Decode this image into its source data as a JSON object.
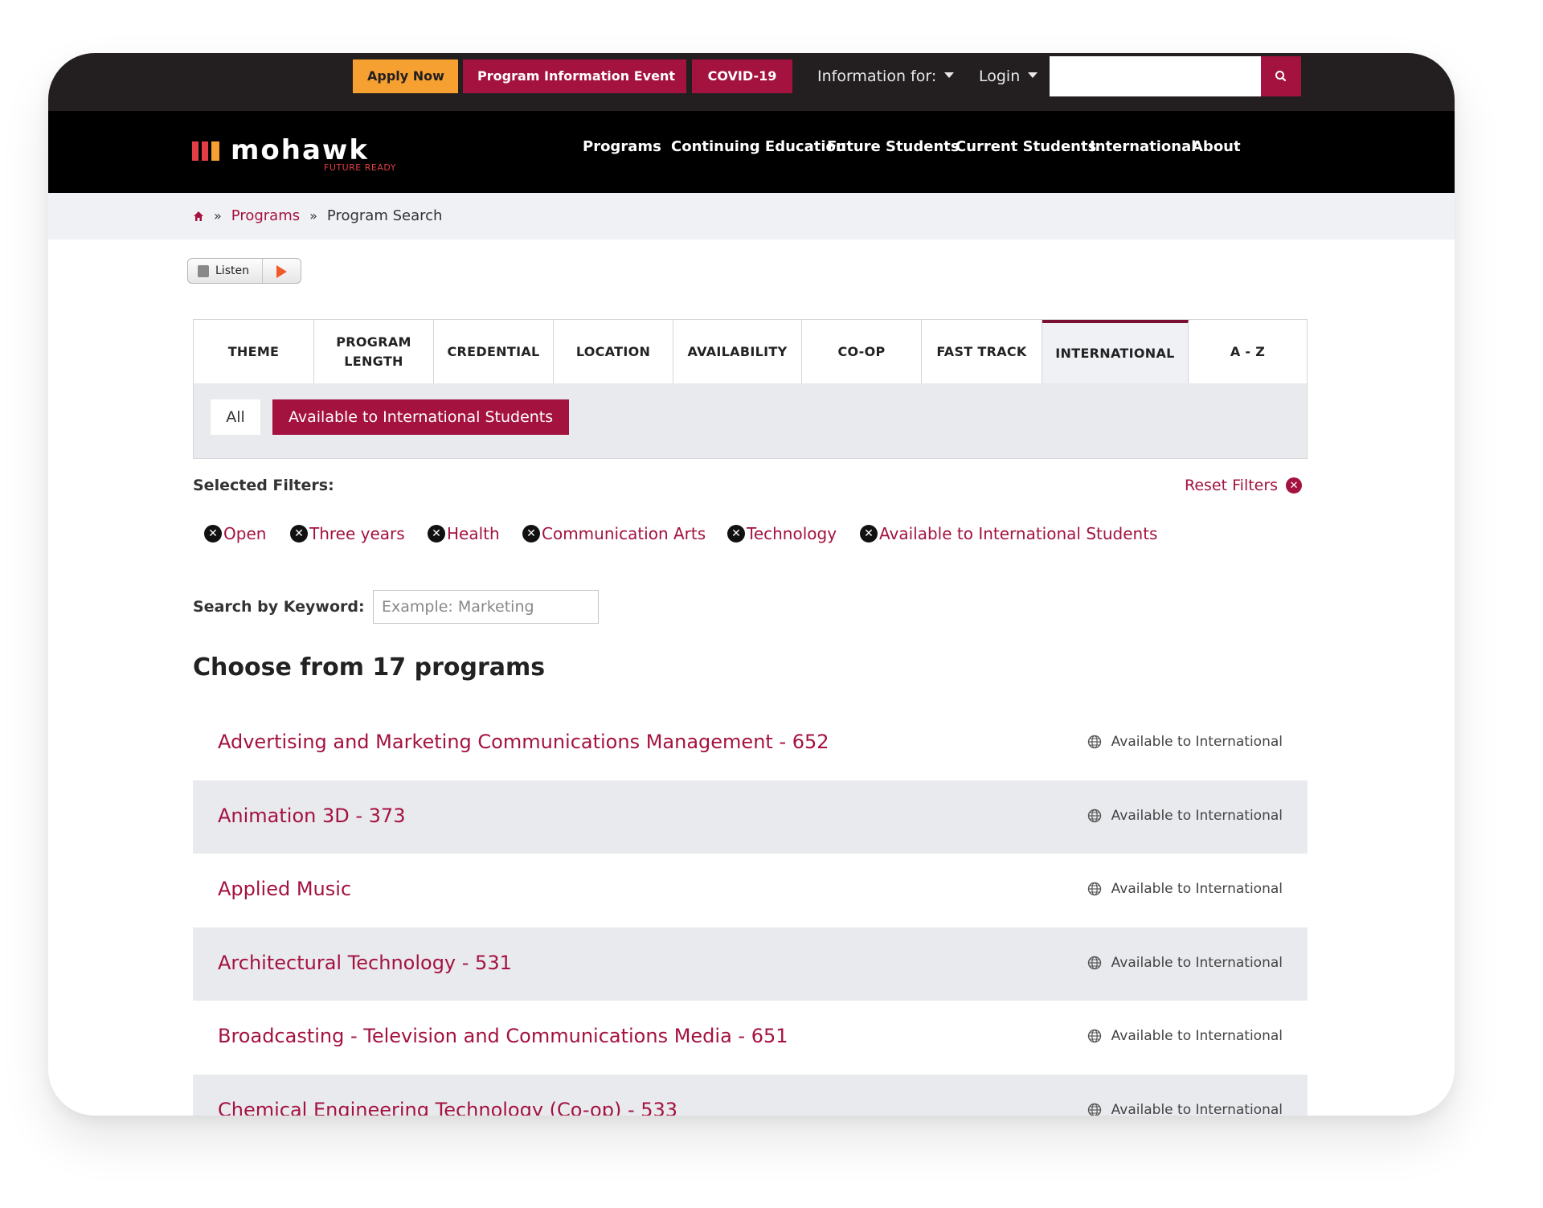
{
  "utility": {
    "apply": "Apply Now",
    "event": "Program Information Event",
    "covid": "COVID-19",
    "info_for": "Information for:",
    "login": "Login",
    "search_value": ""
  },
  "brand": {
    "name": "mohawk",
    "tagline": "FUTURE READY",
    "bar_colors": [
      "#e33d46",
      "#e33d46",
      "#f5a031"
    ]
  },
  "nav": {
    "items": [
      "Programs",
      "Continuing Education",
      "Future Students",
      "Current Students",
      "International",
      "About"
    ]
  },
  "breadcrumb": {
    "sep": "»",
    "programs": "Programs",
    "current": "Program Search"
  },
  "listen": {
    "label": "Listen"
  },
  "tabs": [
    {
      "label": "THEME"
    },
    {
      "label": "PROGRAM LENGTH"
    },
    {
      "label": "CREDENTIAL"
    },
    {
      "label": "LOCATION"
    },
    {
      "label": "AVAILABILITY"
    },
    {
      "label": "CO-OP"
    },
    {
      "label": "FAST TRACK"
    },
    {
      "label": "INTERNATIONAL",
      "active": true
    },
    {
      "label": "A - Z"
    }
  ],
  "panel": {
    "all": "All",
    "intl": "Available to International Students"
  },
  "filters": {
    "heading": "Selected Filters:",
    "reset": "Reset Filters",
    "chips": [
      "Open",
      "Three years",
      "Health",
      "Communication Arts",
      "Technology",
      "Available to International Students"
    ]
  },
  "keyword": {
    "label": "Search by Keyword:",
    "placeholder": "Example: Marketing",
    "value": ""
  },
  "results": {
    "heading": "Choose from 17 programs",
    "badge": "Available to International",
    "items": [
      "Advertising and Marketing Communications Management - 652",
      "Animation 3D - 373",
      "Applied Music",
      "Architectural Technology - 531",
      "Broadcasting - Television and Communications Media - 651",
      "Chemical Engineering Technology (Co-op) - 533"
    ]
  },
  "colors": {
    "brand_red": "#a4123f",
    "apply_orange": "#f5a031",
    "utility_bg": "#231f20",
    "nav_bg": "#000000",
    "panel_bg": "#e9eaee"
  }
}
